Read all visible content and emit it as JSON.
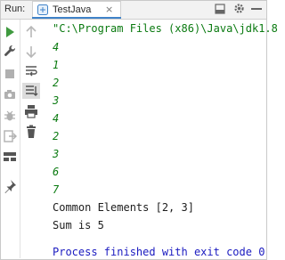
{
  "header": {
    "run_label": "Run:",
    "tab_title": "TestJava",
    "tab_close": "×"
  },
  "console": {
    "command": "\"C:\\Program Files (x86)\\Java\\jdk1.8",
    "numbers": [
      "4",
      "1",
      "2",
      "3",
      "4",
      "2",
      "3",
      "6",
      "7"
    ],
    "common_elements": "Common Elements [2, 3]",
    "sum": "Sum is 5",
    "exit_message": "Process finished with exit code 0"
  },
  "colors": {
    "green_text": "#0a7a10",
    "exit_text": "#1a1ac0",
    "tab_accent": "#4083c9"
  }
}
